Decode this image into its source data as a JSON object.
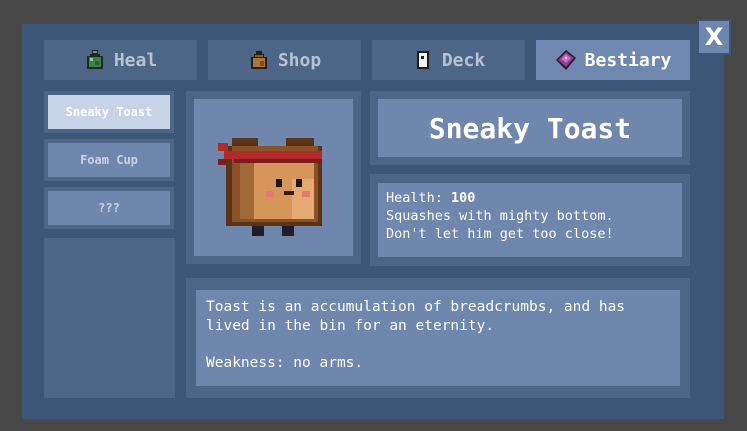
{
  "close_button": {
    "label": "X"
  },
  "tabs": [
    {
      "label": "Heal",
      "icon": "potion-icon",
      "active": false
    },
    {
      "label": "Shop",
      "icon": "bag-icon",
      "active": false
    },
    {
      "label": "Deck",
      "icon": "card-icon",
      "active": false
    },
    {
      "label": "Bestiary",
      "icon": "book-icon",
      "active": true
    }
  ],
  "sidebar": {
    "items": [
      {
        "label": "Sneaky Toast",
        "active": true
      },
      {
        "label": "Foam Cup",
        "active": false
      },
      {
        "label": "???",
        "active": false
      }
    ]
  },
  "monster": {
    "name": "Sneaky Toast",
    "health_label": "Health:",
    "health_value": "100",
    "flavor_line1": "Squashes with mighty bottom.",
    "flavor_line2": "Don't let him get too close!",
    "description": "Toast is an accumulation of breadcrumbs, and has lived in the bin for an eternity.",
    "weakness": "Weakness: no arms."
  },
  "colors": {
    "background": "#474747",
    "panel": "#3d5576",
    "frame": "#4d6688",
    "box": "#6f86ad",
    "active_item": "#c7d3e6"
  }
}
